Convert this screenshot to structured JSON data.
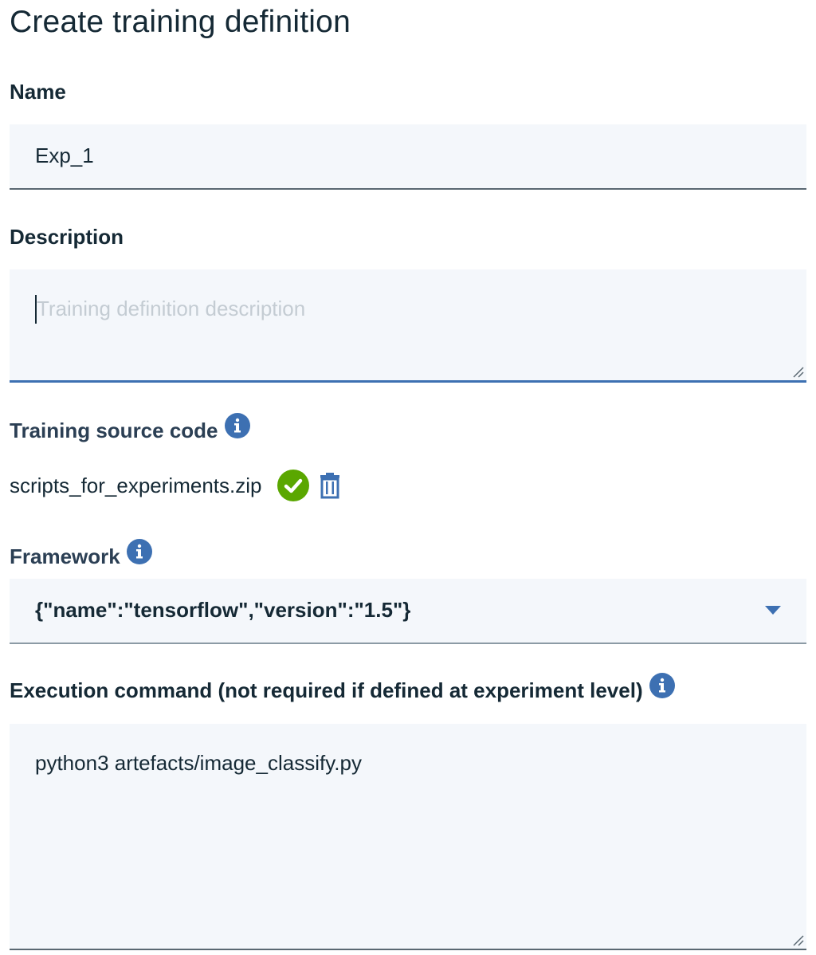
{
  "page": {
    "title": "Create training definition"
  },
  "name_field": {
    "label": "Name",
    "value": "Exp_1"
  },
  "description_field": {
    "label": "Description",
    "placeholder": "Training definition description",
    "value": ""
  },
  "source_code": {
    "label": "Training source code",
    "file_name": "scripts_for_experiments.zip",
    "status_icon": "check-circle-icon",
    "delete_icon": "trash-icon"
  },
  "framework": {
    "label": "Framework",
    "selected": "{\"name\":\"tensorflow\",\"version\":\"1.5\"}"
  },
  "execution_command": {
    "label": "Execution command (not required if defined at experiment level)",
    "value": "python3 artefacts/image_classify.py"
  },
  "colors": {
    "accent": "#3d70b2",
    "success": "#5aa700",
    "field_bg": "#f4f7fb",
    "text": "#152935"
  }
}
